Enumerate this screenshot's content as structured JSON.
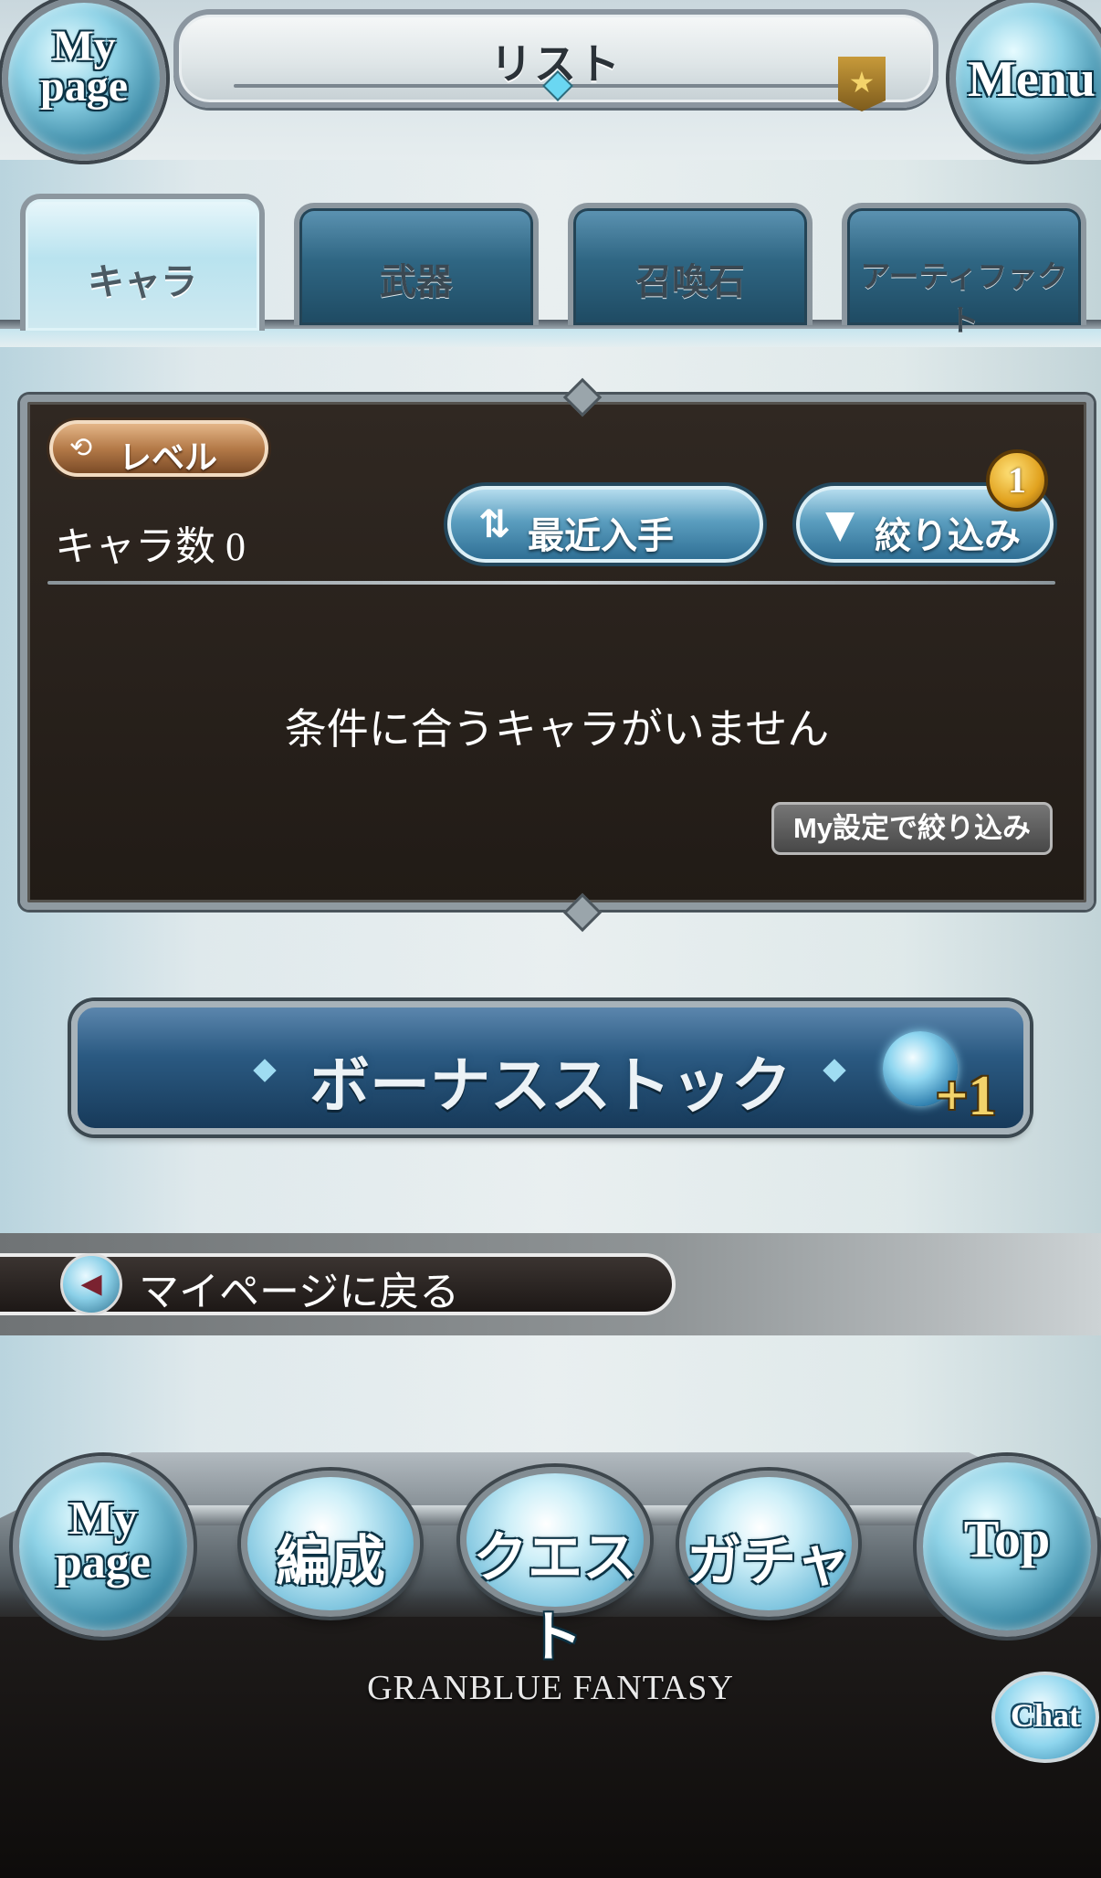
{
  "header": {
    "title": "リスト",
    "mypage_label": "My page",
    "menu_label": "Menu",
    "star_icon": "star-icon"
  },
  "tabs": [
    {
      "label": "キャラ",
      "active": true
    },
    {
      "label": "武器",
      "active": false
    },
    {
      "label": "召喚石",
      "active": false
    },
    {
      "label": "アーティファクト",
      "active": false
    }
  ],
  "panel": {
    "sort_key_label": "レベル",
    "count_label": "キャラ数 0",
    "sort_order_label": "最近入手",
    "filter_label": "絞り込み",
    "filter_badge": "1",
    "empty_message": "条件に合うキャラがいません",
    "my_settings_filter_label": "My設定で絞り込み"
  },
  "bonus": {
    "label": "ボーナスストック",
    "plus": "+1"
  },
  "back": {
    "label": "マイページに戻る"
  },
  "bottom_nav": {
    "mypage": "My page",
    "party": "編成",
    "quest": "クエスト",
    "gacha": "ガチャ",
    "top": "Top",
    "logo": "GRANBLUE FANTASY",
    "chat": "Chat"
  },
  "colors": {
    "tab_active": "#cfe9f0",
    "tab_inactive": "#2f6683",
    "panel_bg": "#211b16",
    "badge_gold": "#e1a21f"
  }
}
